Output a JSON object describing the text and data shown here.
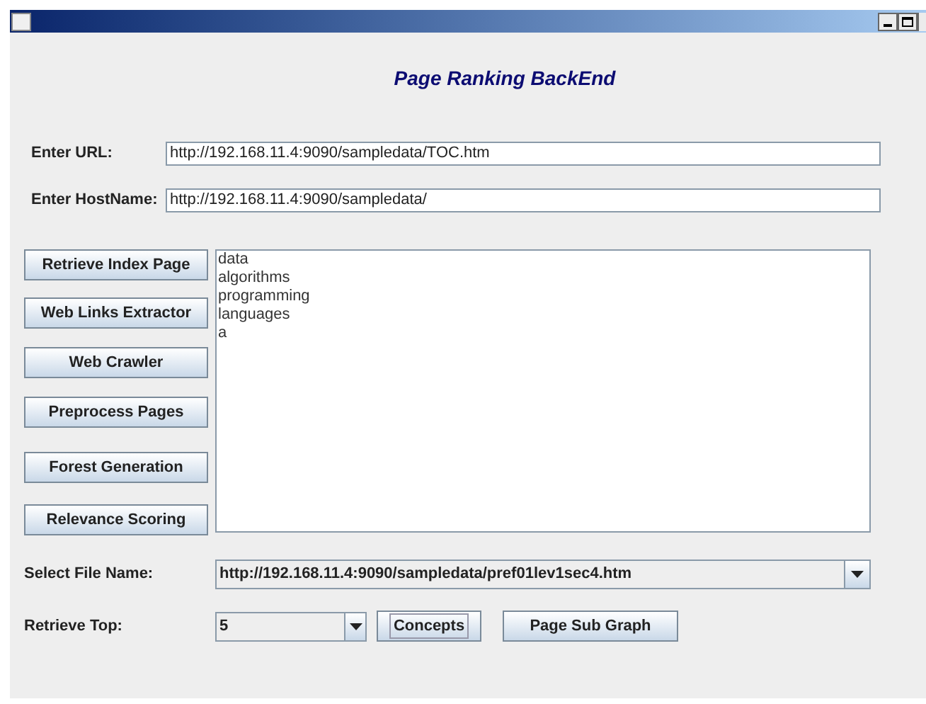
{
  "heading": "Page Ranking BackEnd",
  "fields": [
    {
      "label": "Enter URL:",
      "value": "http://192.168.11.4:9090/sampledata/TOC.htm"
    },
    {
      "label": "Enter HostName:",
      "value": "http://192.168.11.4:9090/sampledata/"
    }
  ],
  "actions": [
    "Retrieve Index Page",
    "Web Links Extractor",
    "Web Crawler",
    "Preprocess Pages",
    "Forest Generation",
    "Relevance Scoring"
  ],
  "output_lines": [
    "data",
    "algorithms",
    "programming",
    "languages",
    "a"
  ],
  "file_select": {
    "label": "Select File Name:",
    "value": "http://192.168.11.4:9090/sampledata/pref01lev1sec4.htm"
  },
  "retrieve_top": {
    "label": "Retrieve Top:",
    "value": "5"
  },
  "bottom_buttons": [
    {
      "label": "Concepts",
      "focused": true
    },
    {
      "label": "Page Sub Graph",
      "focused": false
    }
  ]
}
